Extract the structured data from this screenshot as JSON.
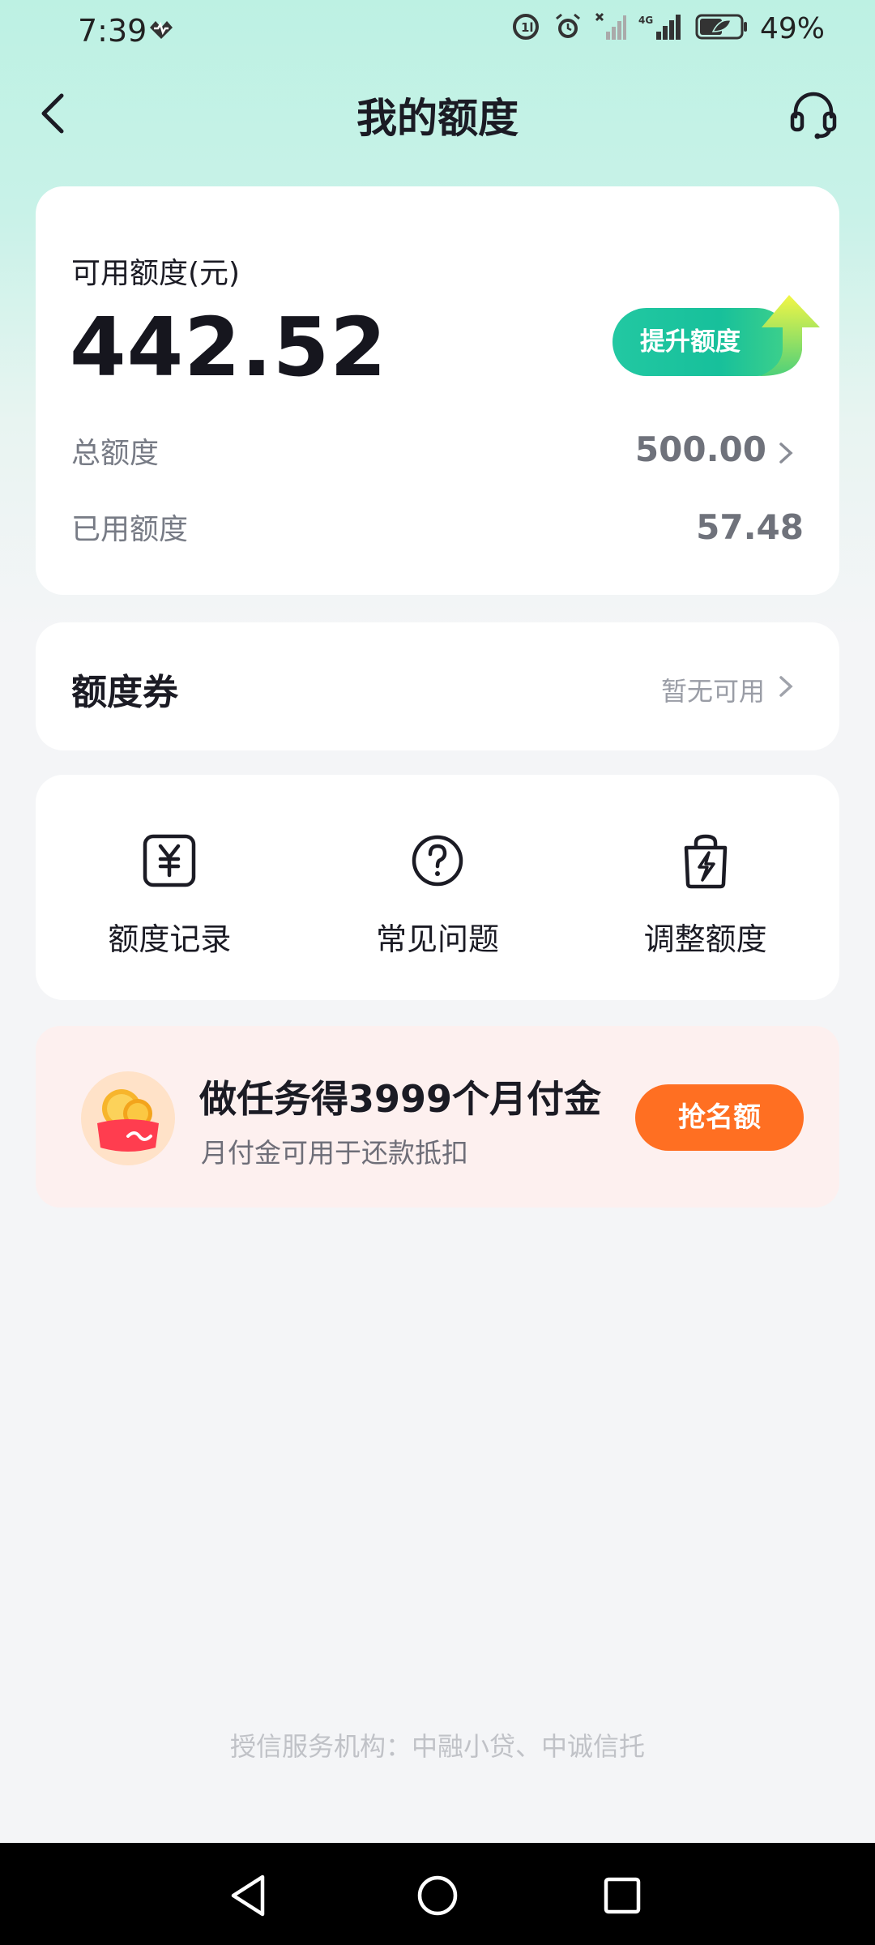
{
  "status_bar": {
    "time": "7:39",
    "battery": "49%",
    "network": "4G",
    "icons": [
      "heart-monitor-icon",
      "data-saver-icon",
      "alarm-icon",
      "no-signal-icon",
      "signal-icon",
      "battery-icon"
    ]
  },
  "header": {
    "title": "我的额度",
    "back_icon": "chevron-left-icon",
    "service_icon": "headset-icon"
  },
  "quota": {
    "available_label": "可用额度(元)",
    "available_amount": "442.52",
    "raise_button": "提升额度",
    "total_label": "总额度",
    "total_value": "500.00",
    "used_label": "已用额度",
    "used_value": "57.48"
  },
  "coupon": {
    "title": "额度券",
    "status": "暂无可用"
  },
  "actions": [
    {
      "label": "额度记录",
      "icon": "yuan-receipt-icon"
    },
    {
      "label": "常见问题",
      "icon": "question-circle-icon"
    },
    {
      "label": "调整额度",
      "icon": "lightning-bag-icon"
    }
  ],
  "promo": {
    "title": "做任务得3999个月付金",
    "subtitle": "月付金可用于还款抵扣",
    "button": "抢名额",
    "icon": "coin-wallet-icon"
  },
  "footer": {
    "text": "授信服务机构：中融小贷、中诚信托"
  },
  "nav": {
    "back": "triangle-back-icon",
    "home": "circle-home-icon",
    "recents": "square-recents-icon"
  },
  "colors": {
    "accent_green": "#1ec59f",
    "promo_orange": "#ff6f22",
    "promo_bg": "#fdf0ef",
    "header_gradient_top": "#bdf1e3"
  }
}
